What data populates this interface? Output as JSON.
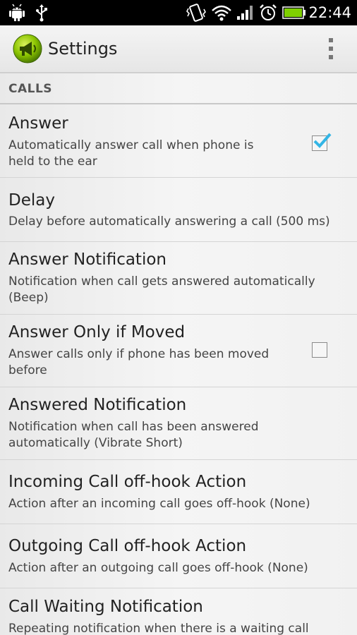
{
  "status_bar": {
    "time": "22:44",
    "icons": [
      "android-debug-icon",
      "usb-icon",
      "vibrate-icon",
      "wifi-icon",
      "signal-icon",
      "alarm-icon",
      "battery-icon"
    ]
  },
  "action_bar": {
    "title": "Settings",
    "app_icon": "megaphone-icon",
    "overflow_icon": "overflow-menu-icon"
  },
  "category": {
    "label": "CALLS"
  },
  "preferences": [
    {
      "title": "Answer",
      "summary": "Automatically answer call when phone is held to the ear",
      "checkbox": true,
      "checked": true
    },
    {
      "title": "Delay",
      "summary": "Delay before automatically answering a call (500 ms)",
      "checkbox": false
    },
    {
      "title": "Answer Notification",
      "summary": "Notification when call gets answered automatically (Beep)",
      "checkbox": false
    },
    {
      "title": "Answer Only if Moved",
      "summary": "Answer calls only if phone has been moved before",
      "checkbox": true,
      "checked": false
    },
    {
      "title": "Answered Notification",
      "summary": "Notification when call has been answered automatically (Vibrate Short)",
      "checkbox": false
    },
    {
      "title": "Incoming Call off-hook Action",
      "summary": "Action after an incoming call goes off-hook (None)",
      "checkbox": false
    },
    {
      "title": "Outgoing Call off-hook Action",
      "summary": "Action after an outgoing call goes off-hook (None)",
      "checkbox": false
    },
    {
      "title": "Call Waiting Notification",
      "summary": "Repeating notification when there is a waiting call",
      "checkbox": false
    }
  ],
  "colors": {
    "check_accent": "#33b5e5",
    "app_icon": "#8bc400"
  }
}
